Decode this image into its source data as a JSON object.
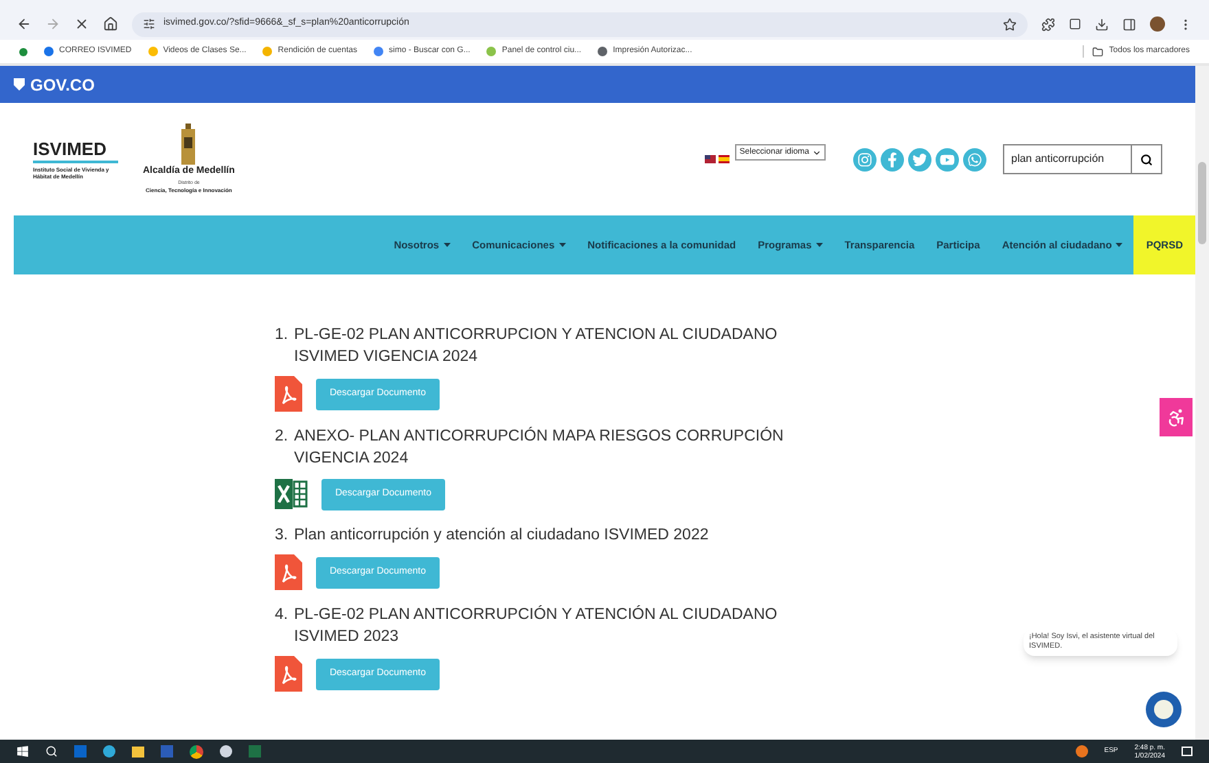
{
  "browser": {
    "url": "isvimed.gov.co/?sfid=9666&_sf_s=plan%20anticorrupción",
    "bookmarks": [
      {
        "label": "CORREO ISVIMED",
        "color": "#1a73e8"
      },
      {
        "label": "Videos de Clases Se...",
        "color": "#fbbc04"
      },
      {
        "label": "Rendición de cuentas",
        "color": "#f4b400"
      },
      {
        "label": "simo - Buscar con G...",
        "color": "#4285f4"
      },
      {
        "label": "Panel de control ciu...",
        "color": "#8bc34a"
      },
      {
        "label": "Impresión Autorizac...",
        "color": "#5f6368"
      }
    ],
    "all_bookmarks": "Todos los marcadores"
  },
  "gov_bar": {
    "label": "GOV.CO"
  },
  "header": {
    "logo_title": "ISVIMED",
    "logo_subtitle": "Instituto Social de Vivienda y Hábitat de Medellín",
    "city_title": "Alcaldía de Medellín",
    "city_line1": "Distrito de",
    "city_line2": "Ciencia, Tecnología e Innovación",
    "language_select": "Seleccionar idioma",
    "search_value": "plan anticorrupción"
  },
  "nav": [
    {
      "label": "Nosotros",
      "dropdown": true,
      "highlighted": false
    },
    {
      "label": "Comunicaciones",
      "dropdown": true,
      "highlighted": false
    },
    {
      "label": "Notificaciones a la comunidad",
      "dropdown": false,
      "highlighted": false
    },
    {
      "label": "Programas",
      "dropdown": true,
      "highlighted": false
    },
    {
      "label": "Transparencia",
      "dropdown": false,
      "highlighted": false
    },
    {
      "label": "Participa",
      "dropdown": false,
      "highlighted": false
    },
    {
      "label": "Atención al ciudadano",
      "dropdown": true,
      "highlighted": false
    },
    {
      "label": "PQRSD",
      "dropdown": false,
      "highlighted": true
    }
  ],
  "documents": [
    {
      "number": "1.",
      "title": "PL-GE-02 PLAN ANTICORRUPCION Y ATENCION AL CIUDADANO ISVIMED VIGENCIA 2024",
      "kind": "pdf",
      "button": "Descargar Documento"
    },
    {
      "number": "2.",
      "title": "ANEXO- PLAN ANTICORRUPCIÓN MAPA RIESGOS CORRUPCIÓN VIGENCIA 2024",
      "kind": "excel",
      "button": "Descargar Documento"
    },
    {
      "number": "3.",
      "title": "Plan anticorrupción y atención al ciudadano ISVIMED 2022",
      "kind": "pdf",
      "button": "Descargar Documento"
    },
    {
      "number": "4.",
      "title": "PL-GE-02 PLAN ANTICORRUPCIÓN Y ATENCIÓN AL CIUDADANO ISVIMED 2023",
      "kind": "pdf",
      "button": "Descargar Documento"
    }
  ],
  "chat_bubble": "¡Hola! Soy Isvi, el asistente virtual del ISVIMED.",
  "taskbar": {
    "language": "ESP",
    "time": "2:48 p. m.",
    "date": "1/02/2024"
  }
}
